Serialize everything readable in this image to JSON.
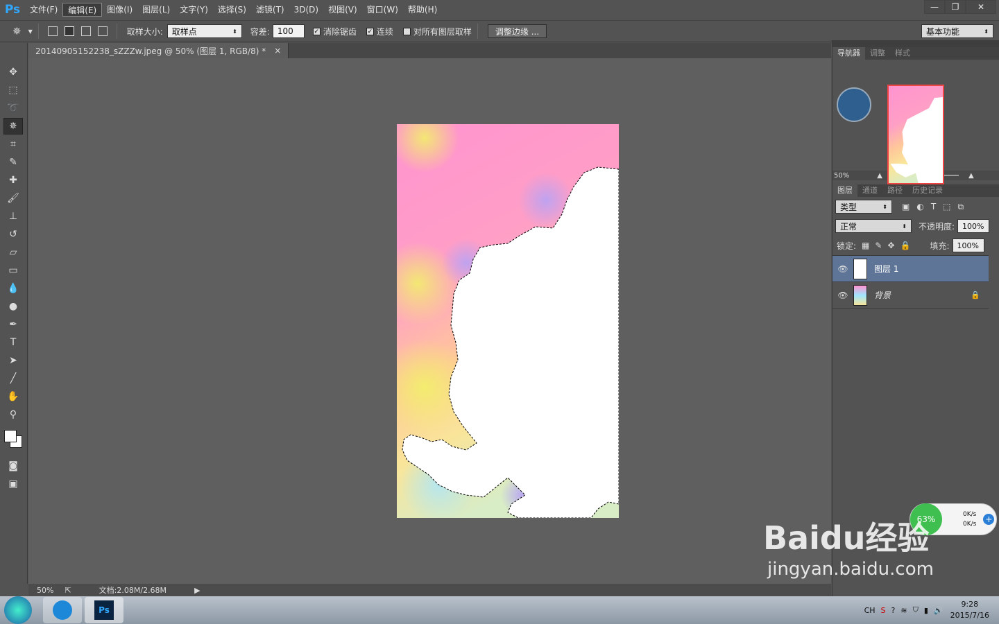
{
  "menubar": {
    "logo": "Ps",
    "items": [
      "文件(F)",
      "编辑(E)",
      "图像(I)",
      "图层(L)",
      "文字(Y)",
      "选择(S)",
      "滤镜(T)",
      "3D(D)",
      "视图(V)",
      "窗口(W)",
      "帮助(H)"
    ],
    "active_index": 1,
    "win_min": "—",
    "win_restore": "❐",
    "win_close": "✕"
  },
  "options": {
    "sample_size_label": "取样大小:",
    "sample_size_value": "取样点",
    "tolerance_label": "容差:",
    "tolerance_value": "100",
    "antialias_label": "消除锯齿",
    "contiguous_label": "连续",
    "all_layers_label": "对所有图层取样",
    "refine_edge_label": "调整边缘 ...",
    "workspace_value": "基本功能"
  },
  "document": {
    "tab_title": "20140905152238_sZZZw.jpeg @ 50% (图层 1, RGB/8) *",
    "close": "×"
  },
  "status": {
    "zoom": "50%",
    "doc_size": "文档:2.08M/2.68M"
  },
  "navigator": {
    "tabs": [
      "导航器",
      "调整",
      "样式"
    ],
    "zoom": "50%"
  },
  "layers_panel": {
    "tabs": [
      "图层",
      "通道",
      "路径",
      "历史记录"
    ],
    "filter_kind": "类型",
    "blend_mode": "正常",
    "opacity_label": "不透明度:",
    "opacity_value": "100%",
    "lock_label": "锁定:",
    "fill_label": "填充:",
    "fill_value": "100%",
    "layers": [
      {
        "name": "图层 1",
        "selected": true,
        "locked": false
      },
      {
        "name": "背景",
        "selected": false,
        "locked": true
      }
    ]
  },
  "network_widget": {
    "percent": "63%",
    "up": "0K/s",
    "down": "0K/s"
  },
  "taskbar": {
    "tray_lang": "CH",
    "time": "9:28",
    "date": "2015/7/16"
  },
  "watermark": {
    "brand": "Baidu经验",
    "url": "jingyan.baidu.com"
  },
  "colors": {
    "ui_bg": "#535353",
    "canvas_bg": "#5f5f5f",
    "selected_layer": "#5f7597",
    "accent": "#31a8ff"
  }
}
